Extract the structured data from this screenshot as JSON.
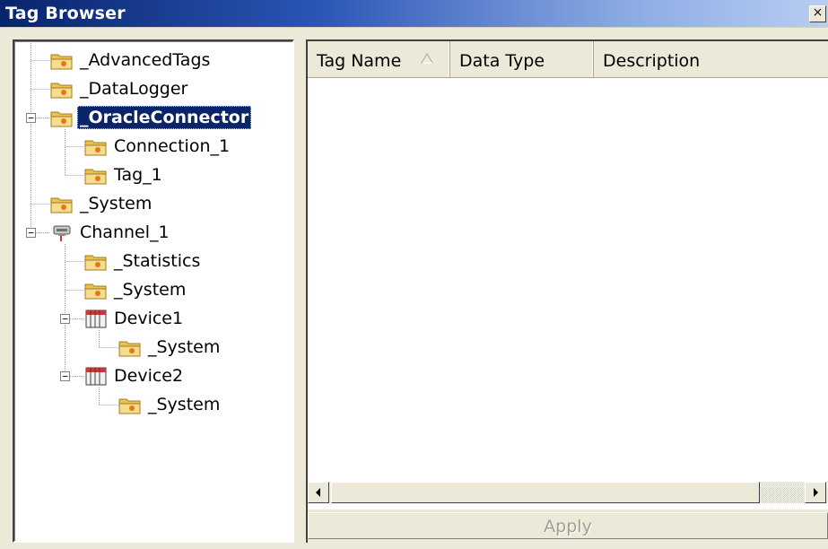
{
  "window": {
    "title": "Tag Browser",
    "close_glyph": "×"
  },
  "tree": {
    "items": [
      {
        "label": "_AdvancedTags",
        "icon": "folder-icon"
      },
      {
        "label": "_DataLogger",
        "icon": "folder-icon"
      },
      {
        "label": "_OracleConnector",
        "icon": "folder-icon",
        "selected": true,
        "expanded": true
      },
      {
        "label": "Connection_1",
        "icon": "folder-icon"
      },
      {
        "label": "Tag_1",
        "icon": "folder-icon"
      },
      {
        "label": "_System",
        "icon": "folder-icon"
      },
      {
        "label": "Channel_1",
        "icon": "channel-icon",
        "expanded": true
      },
      {
        "label": "_Statistics",
        "icon": "folder-icon"
      },
      {
        "label": "_System",
        "icon": "folder-icon"
      },
      {
        "label": "Device1",
        "icon": "device-icon",
        "expanded": true
      },
      {
        "label": "_System",
        "icon": "folder-icon"
      },
      {
        "label": "Device2",
        "icon": "device-icon",
        "expanded": true
      },
      {
        "label": "_System",
        "icon": "folder-icon"
      }
    ],
    "collapse_glyph": "−"
  },
  "list": {
    "columns": [
      {
        "label": "Tag Name",
        "sorted": "ascending"
      },
      {
        "label": "Data Type"
      },
      {
        "label": "Description"
      }
    ]
  },
  "apply": {
    "label": "Apply",
    "enabled": false
  },
  "colors": {
    "selection": "#0a246a",
    "title_start": "#08246b",
    "title_end": "#b9cdf2"
  }
}
